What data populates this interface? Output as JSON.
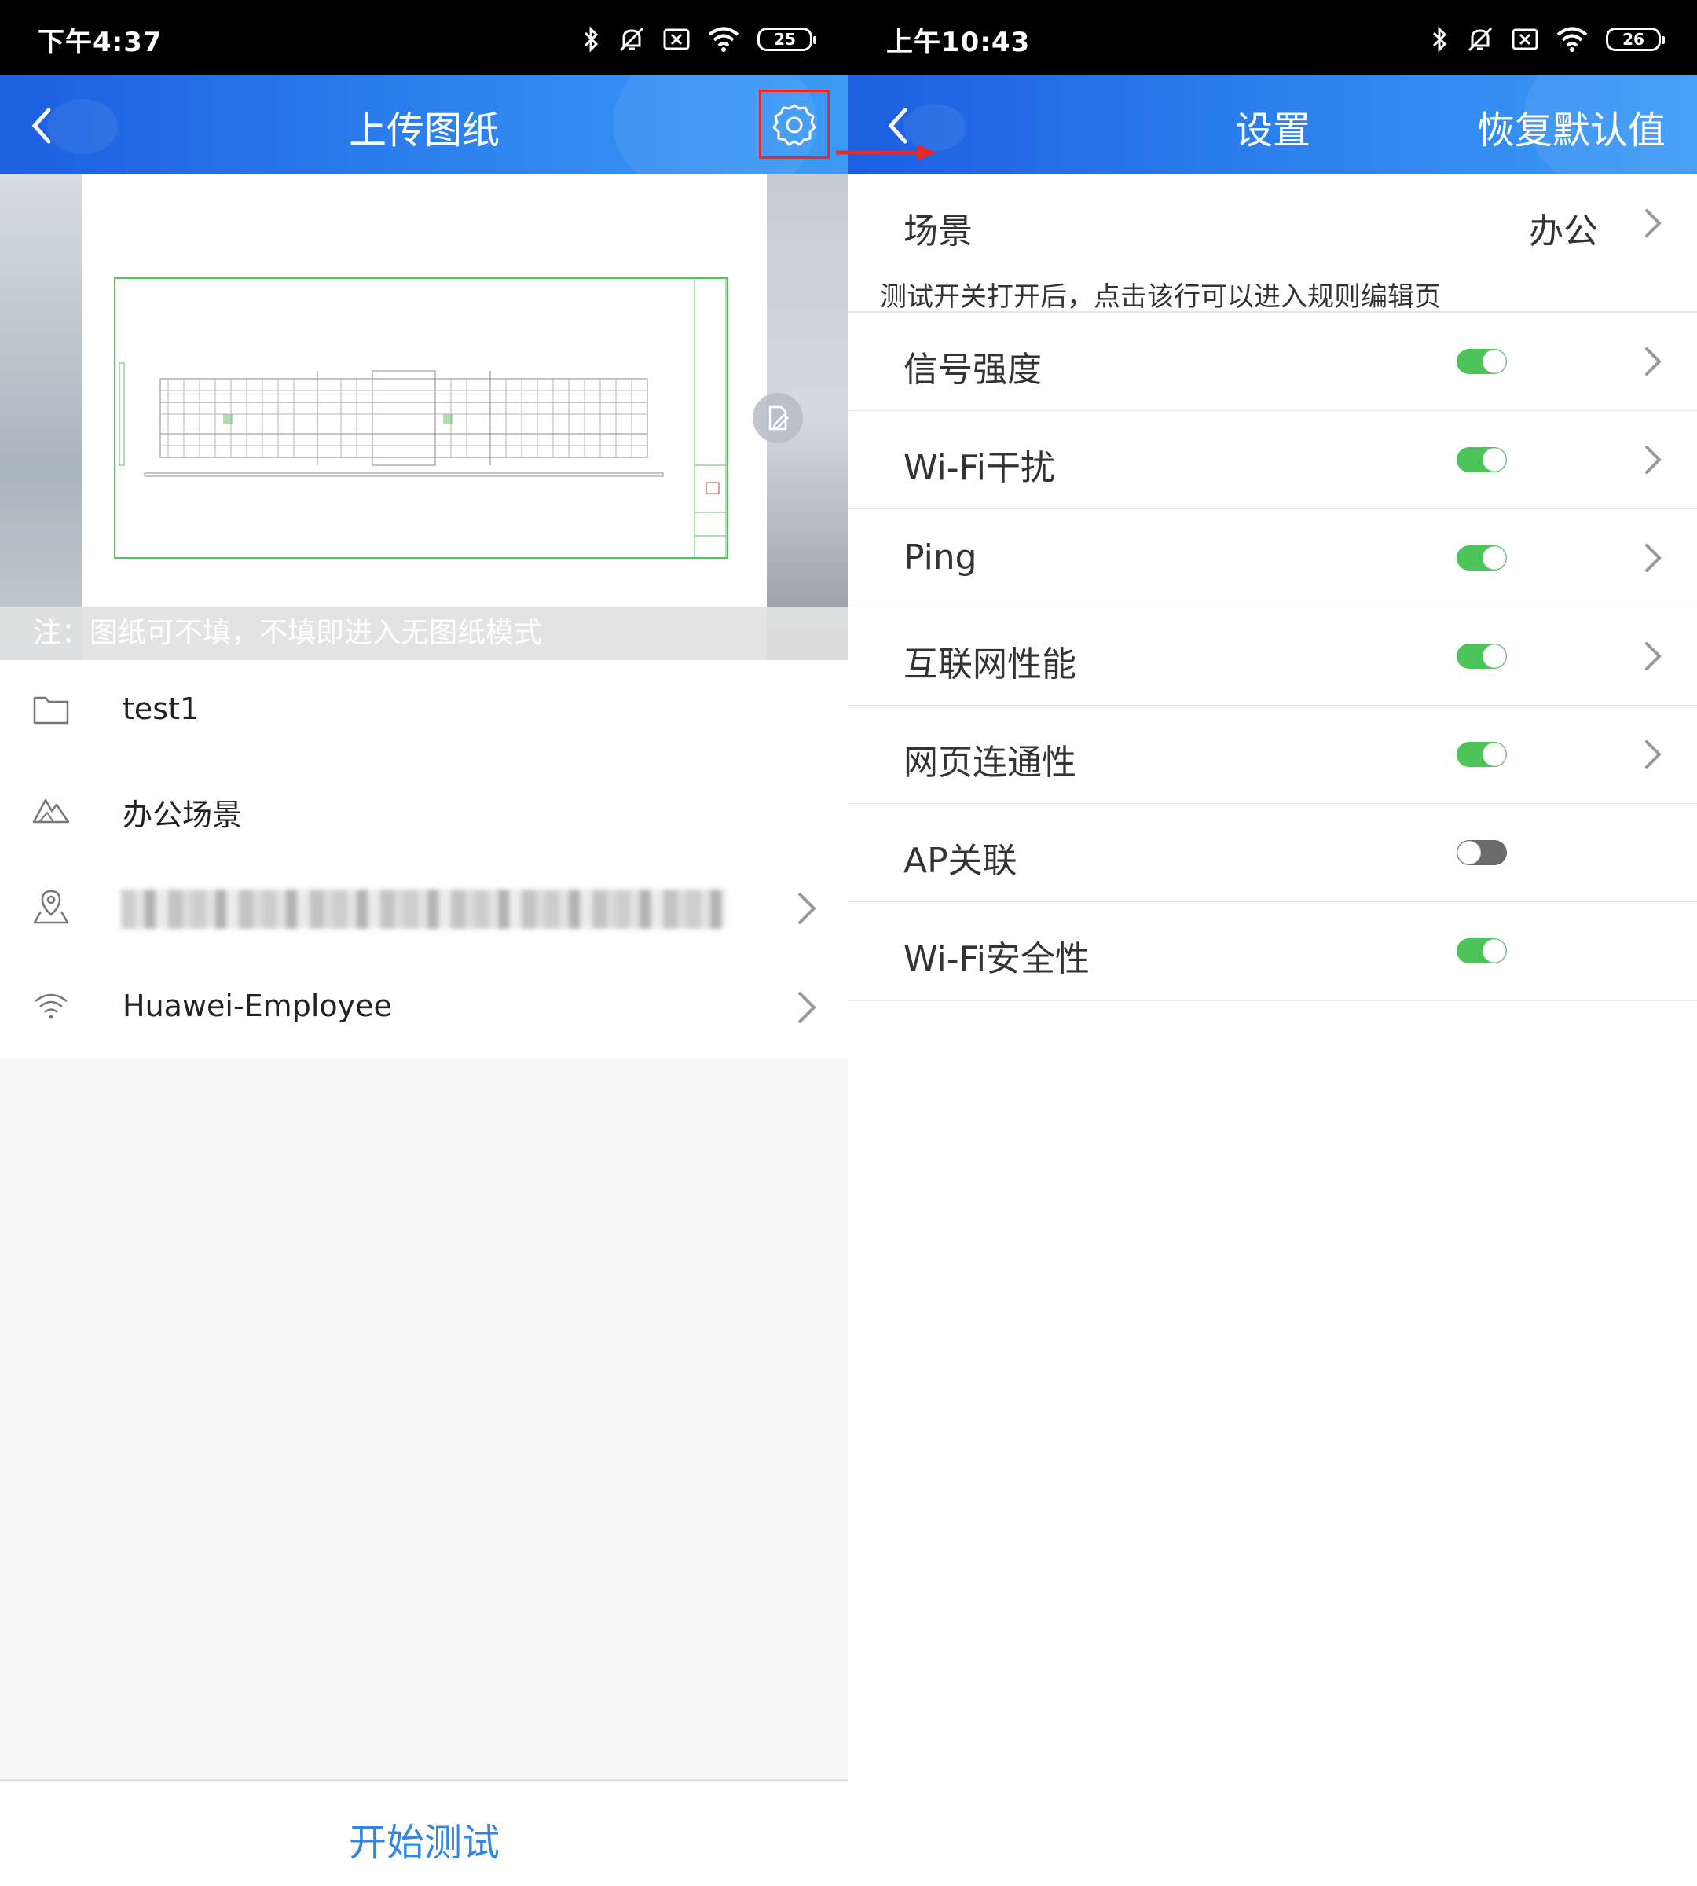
{
  "left": {
    "status_bar": {
      "time": "下午4:37",
      "battery": "25"
    },
    "header": {
      "title": "上传图纸"
    },
    "drawing": {
      "note": "注：图纸可不填，不填即进入无图纸模式"
    },
    "info_items": [
      {
        "icon": "folder-icon",
        "label": "test1"
      },
      {
        "icon": "scene-mountain-icon",
        "label": "办公场景"
      },
      {
        "icon": "map-pin-icon",
        "label": ""
      },
      {
        "icon": "wifi-icon",
        "label": "Huawei-Employee"
      }
    ],
    "footer": {
      "start_button": "开始测试"
    }
  },
  "right": {
    "status_bar": {
      "time": "上午10:43",
      "battery": "26"
    },
    "header": {
      "title": "设置",
      "reset": "恢复默认值"
    },
    "scene_row": {
      "label": "场景",
      "value": "办公"
    },
    "hint": "测试开关打开后，点击该行可以进入规则编辑页",
    "test_items": [
      {
        "label": "信号强度",
        "enabled": true,
        "has_chevron": true
      },
      {
        "label": "Wi-Fi干扰",
        "enabled": true,
        "has_chevron": true
      },
      {
        "label": "Ping",
        "enabled": true,
        "has_chevron": true
      },
      {
        "label": "互联网性能",
        "enabled": true,
        "has_chevron": true
      },
      {
        "label": "网页连通性",
        "enabled": true,
        "has_chevron": true
      },
      {
        "label": "AP关联",
        "enabled": false,
        "has_chevron": false
      },
      {
        "label": "Wi-Fi安全性",
        "enabled": true,
        "has_chevron": false
      }
    ]
  },
  "colors": {
    "accent": "#2f86f0",
    "toggle_on": "#4cc45a",
    "toggle_off": "#6b6b6b",
    "highlight": "#e8282b"
  }
}
